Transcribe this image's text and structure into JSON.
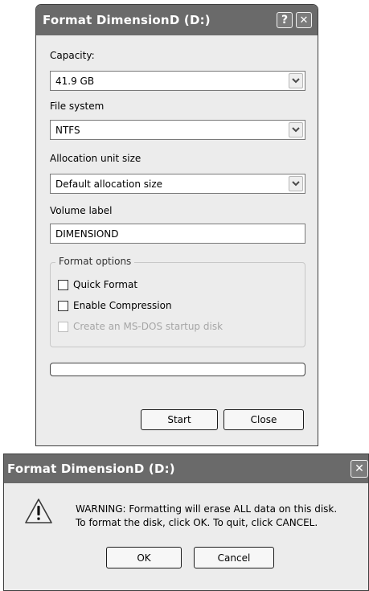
{
  "format_dialog": {
    "title": "Format DimensionD (D:)",
    "help_glyph": "?",
    "close_glyph": "✕",
    "capacity": {
      "label": "Capacity:",
      "value": "41.9 GB"
    },
    "file_system": {
      "label": "File system",
      "value": "NTFS"
    },
    "allocation": {
      "label": "Allocation unit size",
      "value": "Default allocation size"
    },
    "volume_label": {
      "label": "Volume label",
      "value": "DIMENSIOND"
    },
    "format_options": {
      "legend": "Format options",
      "quick_format": {
        "label": "Quick Format",
        "checked": false
      },
      "enable_compression": {
        "label": "Enable Compression",
        "checked": false
      },
      "msdos_startup": {
        "label": "Create an MS-DOS startup disk",
        "checked": false,
        "disabled": true
      }
    },
    "progress": 0,
    "start_label": "Start",
    "close_label": "Close",
    "icons": {
      "dropdown": "chevron-down-icon",
      "help": "help-icon",
      "close": "close-icon"
    }
  },
  "warning_dialog": {
    "title": "Format DimensionD (D:)",
    "close_glyph": "✕",
    "message_line1": "WARNING: Formatting will erase ALL data on this disk.",
    "message_line2": "To format the disk, click OK. To quit, click CANCEL.",
    "ok_label": "OK",
    "cancel_label": "Cancel",
    "icons": {
      "warning": "warning-icon",
      "close": "close-icon"
    }
  },
  "colors": {
    "titlebar": "#6a6a6a",
    "dialog_bg": "#ececec",
    "disabled_text": "#a6a6a6"
  }
}
